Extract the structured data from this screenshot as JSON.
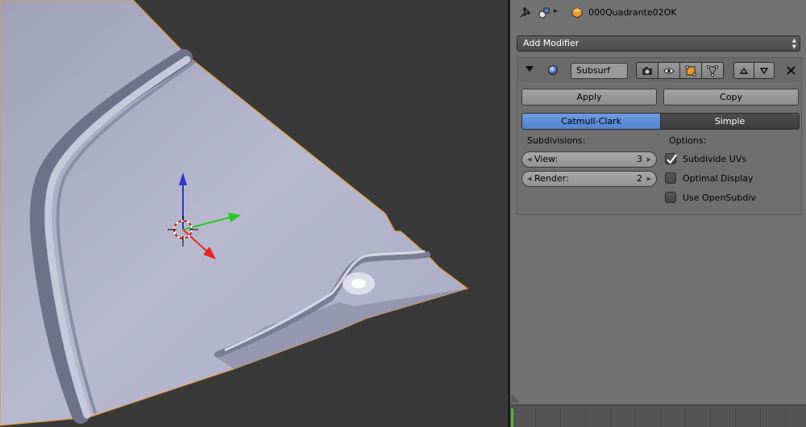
{
  "header": {
    "object_name": "000Quadrante02OK",
    "icons": [
      "pin-icon",
      "context-icon",
      "breadcrumb-arrow-icon",
      "object-cube-icon"
    ]
  },
  "add_modifier": {
    "label": "Add Modifier"
  },
  "modifier": {
    "name": "Subsurf",
    "icons": [
      "collapse-triangle-icon",
      "modifier-sphere-icon",
      "render-camera-icon",
      "eye-icon",
      "editmode-cage-icon",
      "vertex-icon",
      "move-up-icon",
      "move-down-icon",
      "close-icon"
    ],
    "apply_label": "Apply",
    "copy_label": "Copy",
    "algorithms": [
      {
        "label": "Catmull-Clark",
        "active": true
      },
      {
        "label": "Simple",
        "active": false
      }
    ],
    "subdivisions_label": "Subdivisions:",
    "view": {
      "label": "View:",
      "value": "3"
    },
    "render": {
      "label": "Render:",
      "value": "2"
    },
    "options_label": "Options:",
    "options": [
      {
        "label": "Subdivide UVs",
        "checked": true
      },
      {
        "label": "Optimal Display",
        "checked": false
      },
      {
        "label": "Use OpenSubdiv",
        "checked": false
      }
    ]
  },
  "colors": {
    "viewport_bg": "#393939",
    "mesh_surface": "#b0b0c8",
    "selection_outline": "#e39a3e",
    "panel_bg": "#727272",
    "active_blue": "#5c8ad6",
    "axis_x": "#e32626",
    "axis_y": "#27c727",
    "axis_z": "#2a3ad0",
    "timeline_current": "#5fb13a"
  }
}
